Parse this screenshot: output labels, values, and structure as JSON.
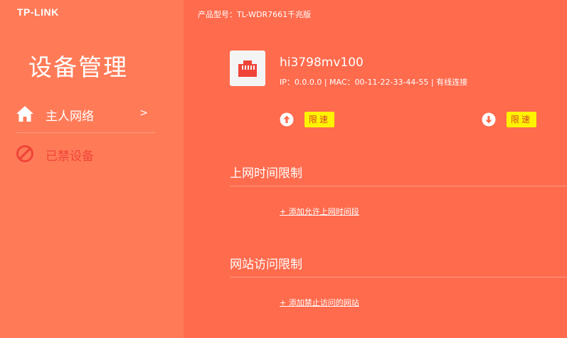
{
  "header": {
    "logo": "TP-LINK",
    "model_label": "产品型号：TL-WDR7661千兆版"
  },
  "sidebar": {
    "title": "设备管理",
    "items": [
      {
        "label": "主人网络",
        "chevron": ">",
        "icon": "home-icon",
        "active": true
      },
      {
        "label": "已禁设备",
        "icon": "ban-icon",
        "active": false
      }
    ]
  },
  "device": {
    "icon": "ethernet-port-icon",
    "name": "hi3798mv100",
    "info": "IP：0.0.0.0 | MAC：00-11-22-33-44-55 | 有线连接",
    "upload_limit_label": "限速",
    "download_limit_label": "限速"
  },
  "sections": {
    "time_limit": {
      "title": "上网时间限制",
      "add_link": "+ 添加允许上网时间段"
    },
    "site_limit": {
      "title": "网站访问限制",
      "add_link": "+ 添加禁止访问的网站"
    }
  },
  "colors": {
    "main_bg": "#ff6b4d",
    "sidebar_bg": "#ff7b58",
    "badge_bg": "#fff300",
    "blocked_red": "#f04438"
  }
}
